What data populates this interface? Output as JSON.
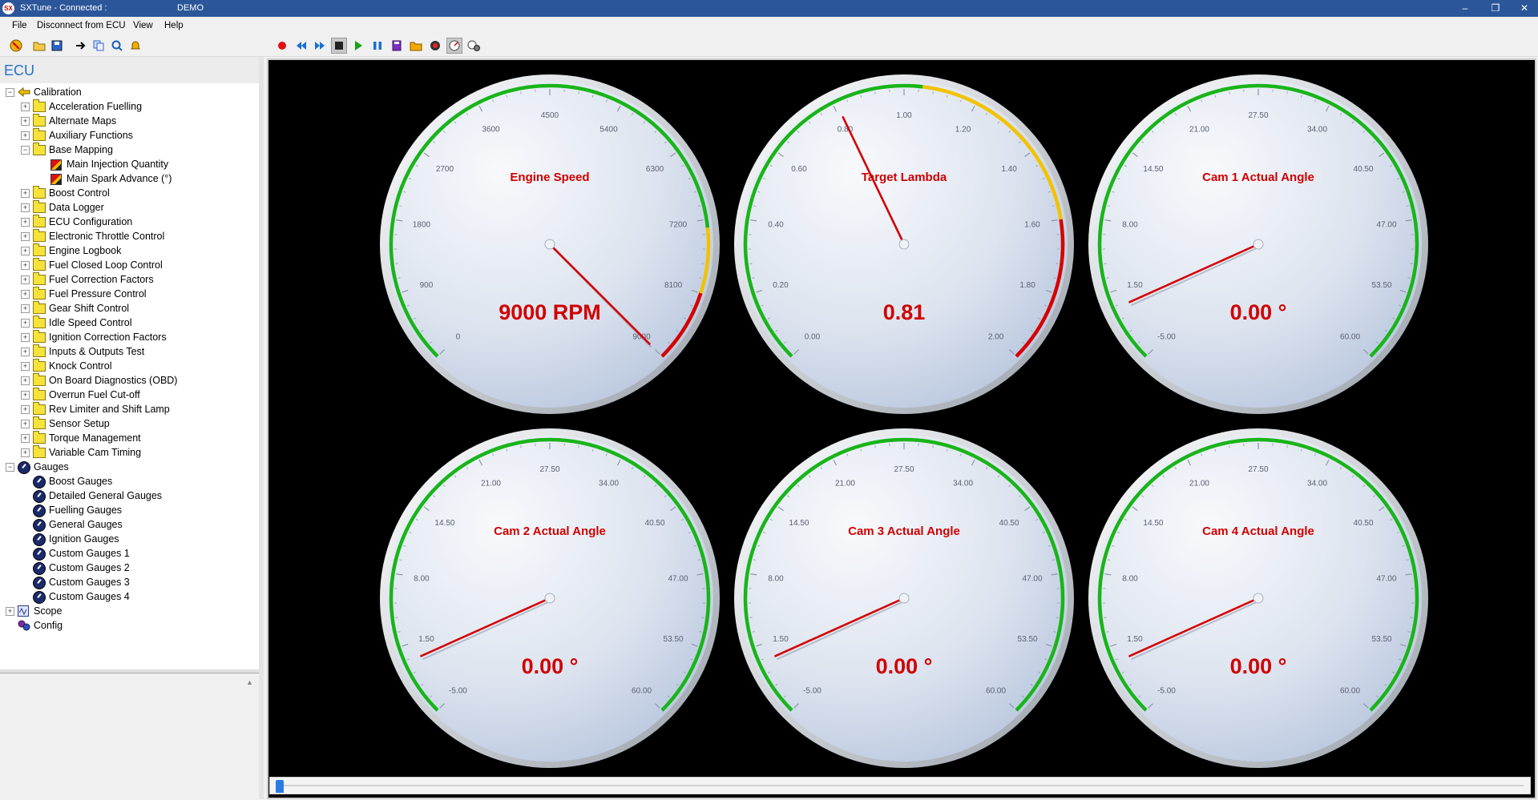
{
  "window": {
    "title": "SXTune - Connected :",
    "connection": "DEMO"
  },
  "menu": [
    "File",
    "Disconnect from ECU",
    "View",
    "Help"
  ],
  "left_pane": {
    "header": "ECU"
  },
  "tree": [
    {
      "label": "Calibration",
      "level": 0,
      "expander": "-",
      "icon": "calib"
    },
    {
      "label": "Acceleration Fuelling",
      "level": 1,
      "expander": "+",
      "icon": "folder"
    },
    {
      "label": "Alternate Maps",
      "level": 1,
      "expander": "+",
      "icon": "folder"
    },
    {
      "label": "Auxiliary Functions",
      "level": 1,
      "expander": "+",
      "icon": "folder"
    },
    {
      "label": "Base Mapping",
      "level": 1,
      "expander": "-",
      "icon": "folder"
    },
    {
      "label": "Main Injection Quantity",
      "level": 2,
      "expander": "",
      "icon": "cube"
    },
    {
      "label": "Main Spark Advance (°)",
      "level": 2,
      "expander": "",
      "icon": "cube"
    },
    {
      "label": "Boost Control",
      "level": 1,
      "expander": "+",
      "icon": "folder"
    },
    {
      "label": "Data Logger",
      "level": 1,
      "expander": "+",
      "icon": "folder"
    },
    {
      "label": "ECU Configuration",
      "level": 1,
      "expander": "+",
      "icon": "folder"
    },
    {
      "label": "Electronic Throttle Control",
      "level": 1,
      "expander": "+",
      "icon": "folder"
    },
    {
      "label": "Engine Logbook",
      "level": 1,
      "expander": "+",
      "icon": "folder"
    },
    {
      "label": "Fuel Closed Loop Control",
      "level": 1,
      "expander": "+",
      "icon": "folder"
    },
    {
      "label": "Fuel Correction Factors",
      "level": 1,
      "expander": "+",
      "icon": "folder"
    },
    {
      "label": "Fuel Pressure Control",
      "level": 1,
      "expander": "+",
      "icon": "folder"
    },
    {
      "label": "Gear Shift Control",
      "level": 1,
      "expander": "+",
      "icon": "folder"
    },
    {
      "label": "Idle Speed Control",
      "level": 1,
      "expander": "+",
      "icon": "folder"
    },
    {
      "label": "Ignition Correction Factors",
      "level": 1,
      "expander": "+",
      "icon": "folder"
    },
    {
      "label": "Inputs & Outputs Test",
      "level": 1,
      "expander": "+",
      "icon": "folder"
    },
    {
      "label": "Knock Control",
      "level": 1,
      "expander": "+",
      "icon": "folder"
    },
    {
      "label": "On Board Diagnostics (OBD)",
      "level": 1,
      "expander": "+",
      "icon": "folder"
    },
    {
      "label": "Overrun Fuel Cut-off",
      "level": 1,
      "expander": "+",
      "icon": "folder"
    },
    {
      "label": "Rev Limiter and Shift Lamp",
      "level": 1,
      "expander": "+",
      "icon": "folder"
    },
    {
      "label": "Sensor Setup",
      "level": 1,
      "expander": "+",
      "icon": "folder"
    },
    {
      "label": "Torque Management",
      "level": 1,
      "expander": "+",
      "icon": "folder"
    },
    {
      "label": "Variable Cam Timing",
      "level": 1,
      "expander": "+",
      "icon": "folder"
    },
    {
      "label": "Gauges",
      "level": 0,
      "expander": "-",
      "icon": "gauge"
    },
    {
      "label": "Boost Gauges",
      "level": 1,
      "expander": "",
      "icon": "gauge"
    },
    {
      "label": "Detailed General Gauges",
      "level": 1,
      "expander": "",
      "icon": "gauge"
    },
    {
      "label": "Fuelling Gauges",
      "level": 1,
      "expander": "",
      "icon": "gauge"
    },
    {
      "label": "General Gauges",
      "level": 1,
      "expander": "",
      "icon": "gauge"
    },
    {
      "label": "Ignition Gauges",
      "level": 1,
      "expander": "",
      "icon": "gauge"
    },
    {
      "label": "Custom Gauges 1",
      "level": 1,
      "expander": "",
      "icon": "gauge"
    },
    {
      "label": "Custom Gauges 2",
      "level": 1,
      "expander": "",
      "icon": "gauge"
    },
    {
      "label": "Custom Gauges 3",
      "level": 1,
      "expander": "",
      "icon": "gauge"
    },
    {
      "label": "Custom Gauges 4",
      "level": 1,
      "expander": "",
      "icon": "gauge"
    },
    {
      "label": "Scope",
      "level": 0,
      "expander": "+",
      "icon": "scope"
    },
    {
      "label": "Config",
      "level": 0,
      "expander": "",
      "icon": "config"
    }
  ],
  "gauges": [
    {
      "title": "Engine Speed",
      "value": "9000 RPM",
      "numeric": 9000,
      "min": 0,
      "max": 9000,
      "ticks": [
        "0",
        "900",
        "1800",
        "2700",
        "3600",
        "4500",
        "5400",
        "6300",
        "7200",
        "8100",
        "9000"
      ],
      "bands": [
        {
          "from": 0,
          "to": 7300,
          "color": "#19b419"
        },
        {
          "from": 7300,
          "to": 8100,
          "color": "#f2c200"
        },
        {
          "from": 8100,
          "to": 9000,
          "color": "#d40000"
        }
      ]
    },
    {
      "title": "Target Lambda",
      "value": "0.81",
      "numeric": 0.81,
      "min": 0,
      "max": 2,
      "ticks": [
        "0.00",
        "0.20",
        "0.40",
        "0.60",
        "0.80",
        "1.00",
        "1.20",
        "1.40",
        "1.60",
        "1.80",
        "2.00"
      ],
      "bands": [
        {
          "from": 0,
          "to": 1.05,
          "color": "#19b419"
        },
        {
          "from": 1.05,
          "to": 1.6,
          "color": "#f2c200"
        },
        {
          "from": 1.6,
          "to": 2.0,
          "color": "#d40000"
        }
      ]
    },
    {
      "title": "Cam 1 Actual Angle",
      "value": "0.00 °",
      "numeric": 0,
      "min": -5,
      "max": 60,
      "ticks": [
        "-5.00",
        "1.50",
        "8.00",
        "14.50",
        "21.00",
        "27.50",
        "34.00",
        "40.50",
        "47.00",
        "53.50",
        "60.00"
      ],
      "bands": [
        {
          "from": -5,
          "to": 60,
          "color": "#19b419"
        }
      ]
    },
    {
      "title": "Cam 2 Actual Angle",
      "value": "0.00 °",
      "numeric": 0,
      "min": -5,
      "max": 60,
      "ticks": [
        "-5.00",
        "1.50",
        "8.00",
        "14.50",
        "21.00",
        "27.50",
        "34.00",
        "40.50",
        "47.00",
        "53.50",
        "60.00"
      ],
      "bands": [
        {
          "from": -5,
          "to": 60,
          "color": "#19b419"
        }
      ]
    },
    {
      "title": "Cam 3 Actual Angle",
      "value": "0.00 °",
      "numeric": 0,
      "min": -5,
      "max": 60,
      "ticks": [
        "-5.00",
        "1.50",
        "8.00",
        "14.50",
        "21.00",
        "27.50",
        "34.00",
        "40.50",
        "47.00",
        "53.50",
        "60.00"
      ],
      "bands": [
        {
          "from": -5,
          "to": 60,
          "color": "#19b419"
        }
      ]
    },
    {
      "title": "Cam 4 Actual Angle",
      "value": "0.00 °",
      "numeric": 0,
      "min": -5,
      "max": 60,
      "ticks": [
        "-5.00",
        "1.50",
        "8.00",
        "14.50",
        "21.00",
        "27.50",
        "34.00",
        "40.50",
        "47.00",
        "53.50",
        "60.00"
      ],
      "bands": [
        {
          "from": -5,
          "to": 60,
          "color": "#19b419"
        }
      ]
    }
  ],
  "colors": {
    "accent": "#2b579a",
    "needle": "#d40000",
    "label": "#d00000"
  },
  "timeline": {
    "position": 0
  }
}
